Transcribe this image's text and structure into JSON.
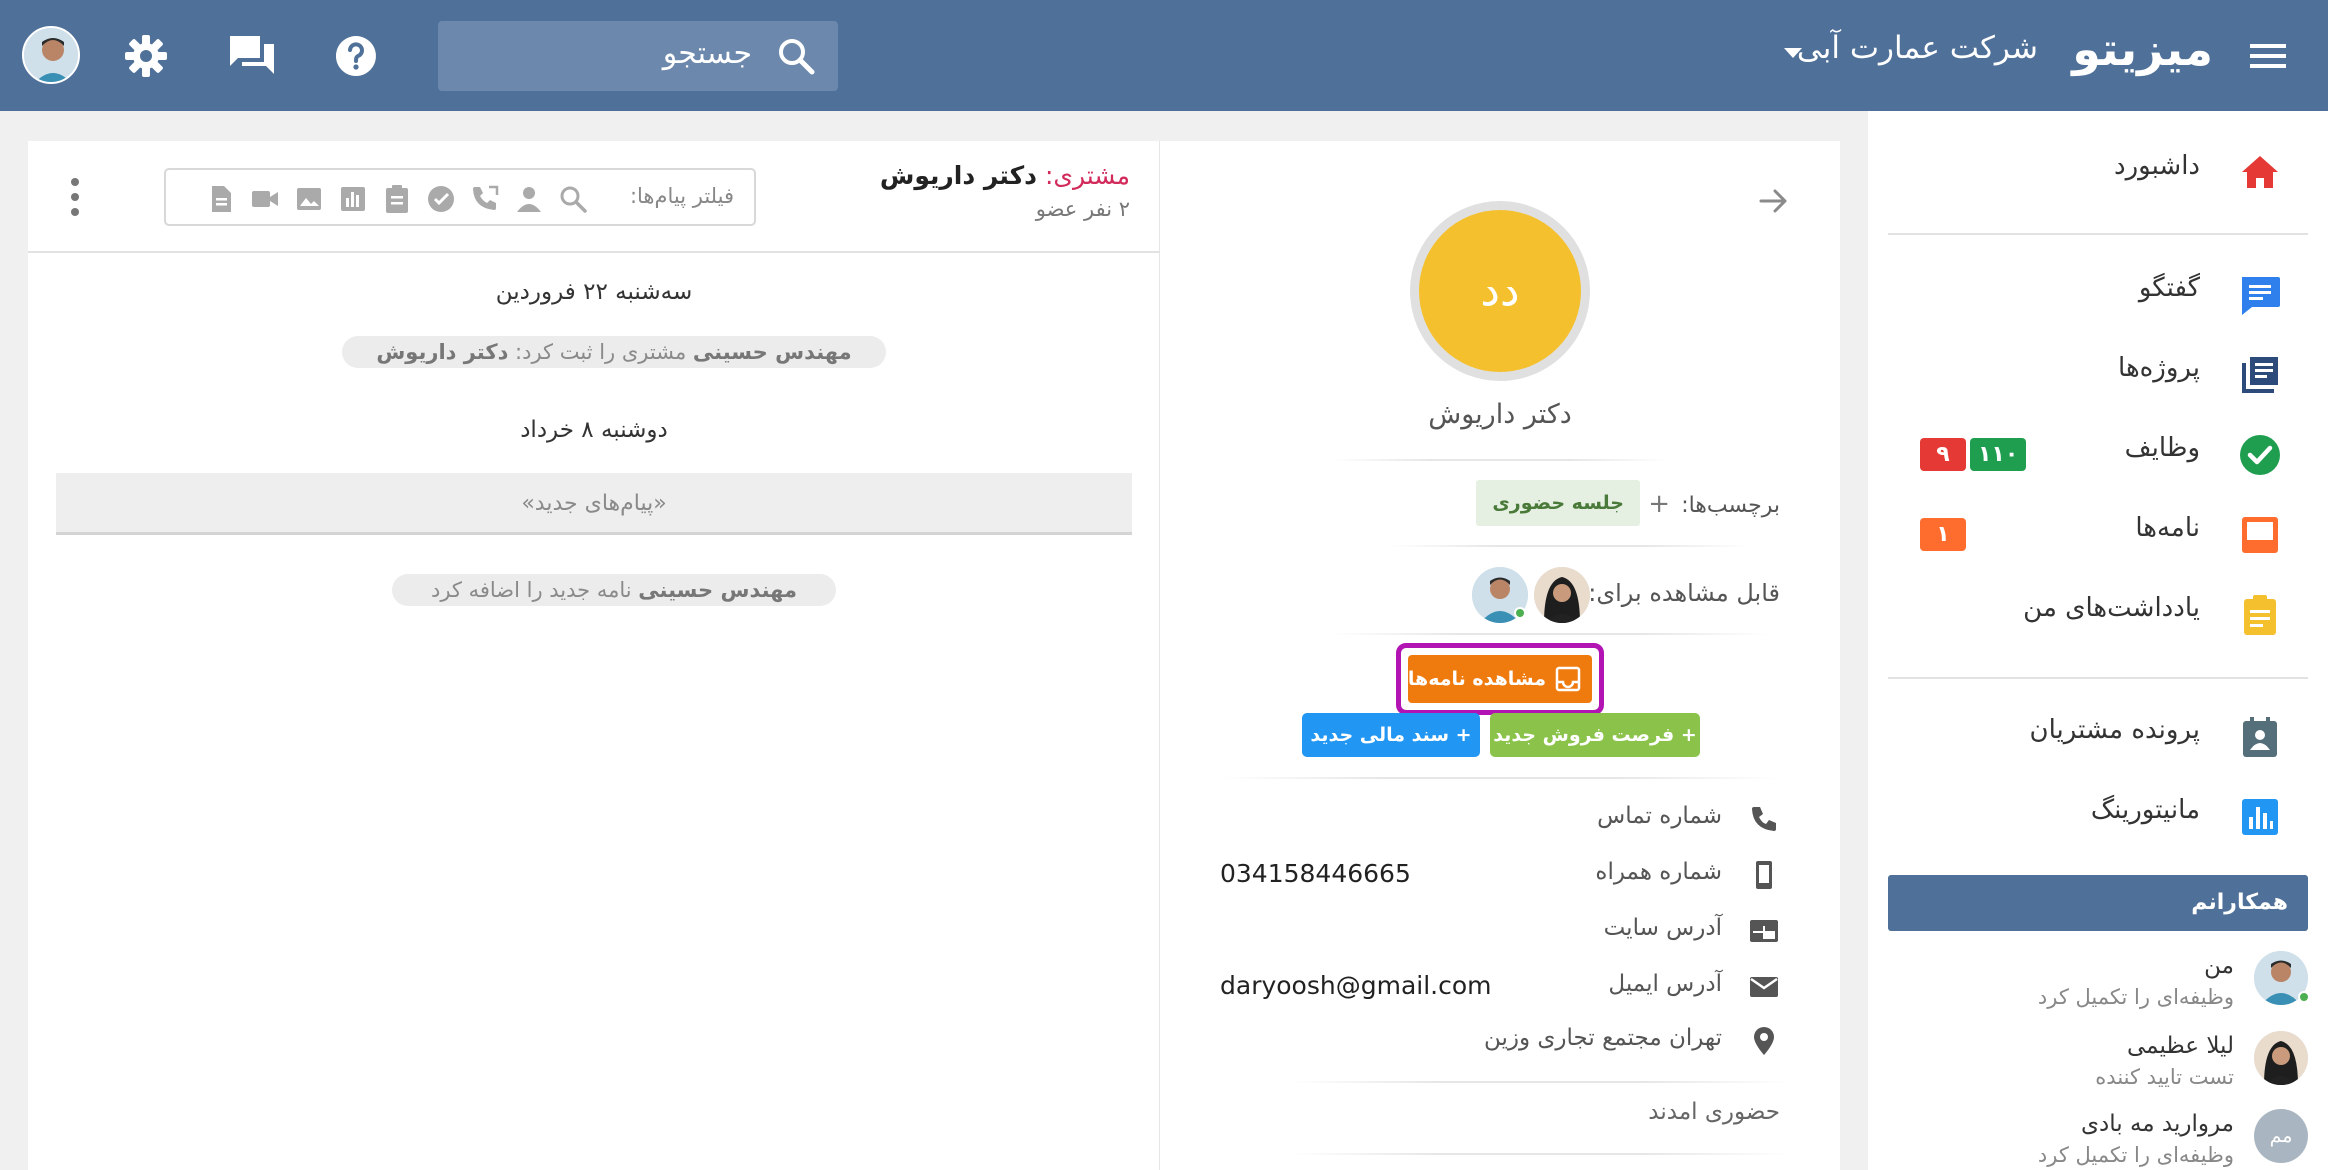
{
  "header": {
    "brand": "میزیتو",
    "company": "شرکت عمارت آبی",
    "search_placeholder": "جستجو"
  },
  "sidebar": {
    "items": [
      {
        "label": "داشبورد",
        "icon": "home-icon"
      },
      {
        "label": "گفتگو",
        "icon": "chat-icon"
      },
      {
        "label": "پروژه‌ها",
        "icon": "projects-icon"
      },
      {
        "label": "وظایف",
        "icon": "task-check-icon",
        "badges": [
          "۱۱۰",
          "۹"
        ]
      },
      {
        "label": "نامه‌ها",
        "icon": "letters-icon",
        "badges": [
          "۱"
        ]
      },
      {
        "label": "یادداشت‌های من",
        "icon": "notes-icon"
      },
      {
        "label": "پرونده مشتریان",
        "icon": "customer-file-icon"
      },
      {
        "label": "مانیتورینگ",
        "icon": "monitoring-icon"
      }
    ],
    "colleagues_title": "همکارانم",
    "colleagues": [
      {
        "name": "من",
        "status": "وظیفه‌ای را تکمیل کرد"
      },
      {
        "name": "لیلا عظیمی",
        "status": "تست تایید کننده"
      },
      {
        "name": "مروارید مه بادی",
        "status": "وظیفه‌ای را تکمیل کرد",
        "initials": "مم"
      }
    ]
  },
  "profile": {
    "initials": "دد",
    "name": "دکتر داریوش",
    "tags_label": "برچسب‌ها:",
    "tag_plus": "+",
    "tag": "جلسه حضوری",
    "visible_label": "قابل مشاهده برای:",
    "view_letters": "مشاهده نامه‌ها",
    "new_opportunity": "+ فرصت فروش جدید",
    "new_finance_doc": "+ سند مالی جدید",
    "fields": [
      {
        "label": "شماره تماس",
        "value": "",
        "icon": "phone-icon"
      },
      {
        "label": "شماره همراه",
        "value": "034158446665",
        "icon": "mobile-icon"
      },
      {
        "label": "آدرس سایت",
        "value": "",
        "icon": "website-icon"
      },
      {
        "label": "آدرس ایمیل",
        "value": "daryoosh@gmail.com",
        "icon": "email-icon"
      },
      {
        "label": "تهران مجتمع تجاری وزین",
        "value": "",
        "icon": "location-icon"
      }
    ],
    "status": "حضوری امدند"
  },
  "chat": {
    "type_label": "مشتری:",
    "title": "دکتر داریوش",
    "members": "۲ نفر عضو",
    "filter_label": "فیلتر پیام‌ها:",
    "date1": "سه‌شنبه ۲۲ فروردین",
    "event1_actor": "مهندس حسینی",
    "event1_text": "مشتری را ثبت کرد:",
    "event1_target": "دکتر داریوش",
    "date2": "دوشنبه ۸ خرداد",
    "new_messages": "«پیام‌های جدید»",
    "event2_actor": "مهندس حسینی",
    "event2_text": "نامه جدید را اضافه کرد"
  },
  "colors": {
    "header": "#4f7098",
    "accent_orange": "#ef7b0f",
    "highlight": "#b214b3",
    "green": "#8bc34a",
    "blue": "#2196f3",
    "badge_red": "#e53935",
    "badge_green": "#1e9e4e",
    "badge_orange": "#ff6d2e"
  }
}
